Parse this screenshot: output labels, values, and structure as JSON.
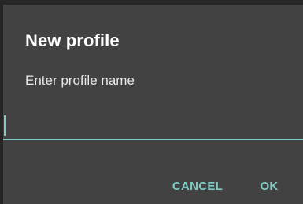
{
  "dialog": {
    "title": "New profile",
    "message": "Enter profile name",
    "input": {
      "value": "",
      "placeholder": ""
    },
    "buttons": {
      "cancel_label": "CANCEL",
      "ok_label": "OK"
    }
  },
  "colors": {
    "background": "#424242",
    "accent": "#80cbc4",
    "title_text": "#ffffff"
  }
}
